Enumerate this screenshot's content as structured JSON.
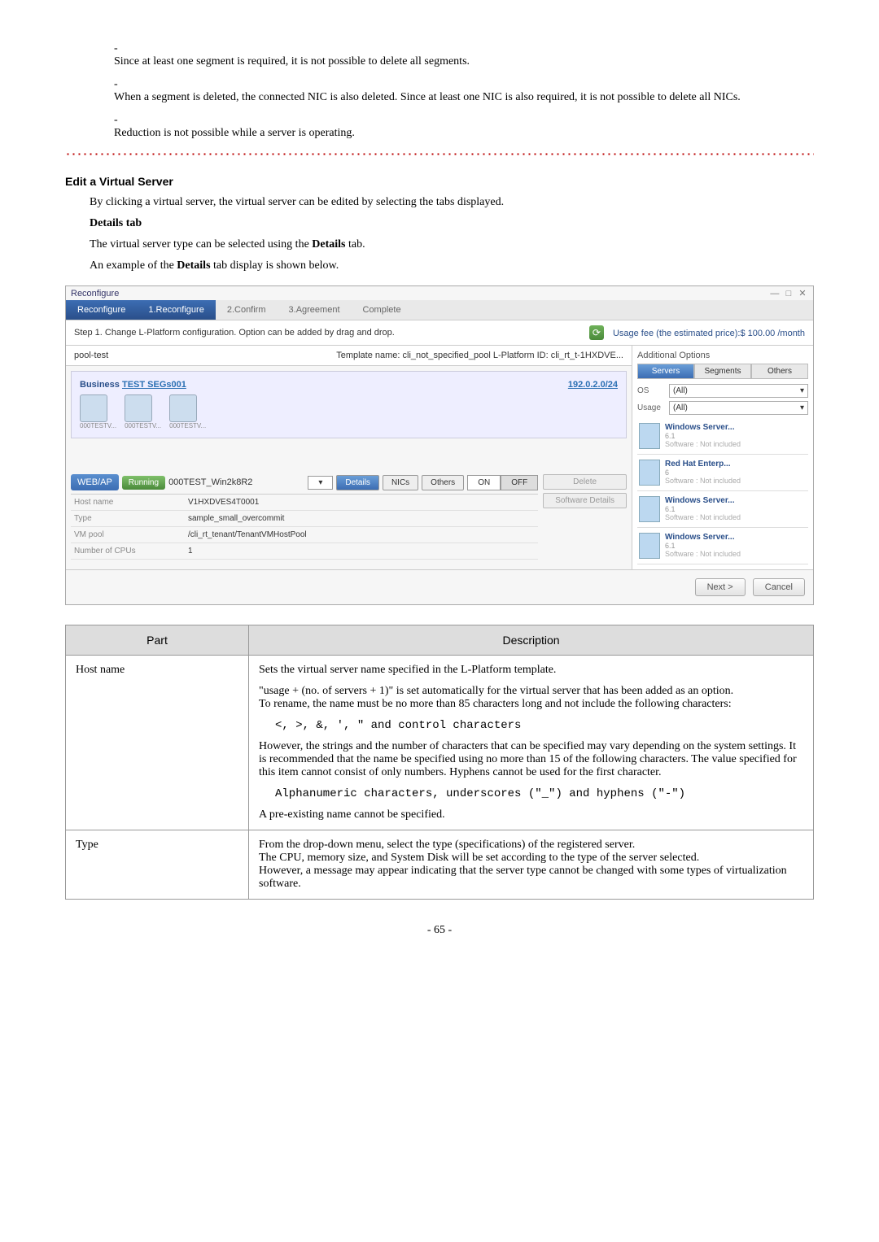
{
  "bullets": {
    "b1": "Since at least one segment is required, it is not possible to delete all segments.",
    "b2": "When a segment is deleted, the connected NIC is also deleted. Since at least one NIC is also required, it is not possible to delete all NICs.",
    "b3": "Reduction is not possible while a server is operating."
  },
  "section_heading": "Edit a Virtual Server",
  "intro_para": "By clicking a virtual server, the virtual server can be edited by selecting the tabs displayed.",
  "details_tab_heading": "Details tab",
  "details_line1_a": "The virtual server type can be selected using the ",
  "details_line1_b": "Details",
  "details_line1_c": " tab.",
  "details_line2_a": "An example of the ",
  "details_line2_b": "Details",
  "details_line2_c": " tab display is shown below.",
  "inset": {
    "window_title": "Reconfigure",
    "steps": {
      "s1": "1.Reconfigure",
      "s2": "2.Confirm",
      "s3": "3.Agreement",
      "s4": "Complete"
    },
    "step1_label": "Reconfigure",
    "step_desc": "Step 1. Change L-Platform configuration. Option can be added by drag and drop.",
    "fee_label": "Usage fee (the estimated price):$",
    "fee_amount": "100.00 /month",
    "pool_name": "pool-test",
    "template_label": "Template name: cli_not_specified_pool  L-Platform ID: cli_rt_t-1HXDVE...",
    "business_label": "Business",
    "business_link": "TEST SEGs001",
    "ip": "192.0.2.0/24",
    "srv_lbl": "000TESTV...",
    "brand": "WEB/AP",
    "status": "Running",
    "srv_name": "000TEST_Win2k8R2",
    "tabs": {
      "details": "Details",
      "nics": "NICs",
      "others": "Others"
    },
    "on": "ON",
    "off": "OFF",
    "detail_rows": {
      "host_name_lbl": "Host name",
      "host_name_val": "V1HXDVES4T0001",
      "type_lbl": "Type",
      "type_val": "sample_small_overcommit",
      "vmpool_lbl": "VM pool",
      "vmpool_val": "/cli_rt_tenant/TenantVMHostPool",
      "cpus_lbl": "Number of CPUs",
      "cpus_val": "1"
    },
    "side_btns": {
      "delete": "Delete",
      "sw": "Software Details"
    },
    "addopt_title": "Additional Options",
    "opt_tabs": {
      "servers": "Servers",
      "segments": "Segments",
      "others": "Others"
    },
    "opt_fields": {
      "os_lbl": "OS",
      "os_val": "(All)",
      "usage_lbl": "Usage",
      "usage_val": "(All)"
    },
    "cards": {
      "c1_name": "Windows Server...",
      "c1_sub": "6.1",
      "c1_sw": "Software : Not included",
      "c2_name": "Red Hat Enterp...",
      "c2_sub": "6",
      "c2_sw": "Software : Not included",
      "c3_name": "Windows Server...",
      "c3_sub": "6.1",
      "c3_sw": "Software : Not included",
      "c4_name": "Windows Server...",
      "c4_sub": "6.1",
      "c4_sw": "Software : Not included"
    },
    "footer": {
      "next": "Next >",
      "cancel": "Cancel"
    }
  },
  "table": {
    "hdr_part": "Part",
    "hdr_desc": "Description",
    "r1_part": "Host name",
    "r1_p1": "Sets the virtual server name specified in the L-Platform template.",
    "r1_p2": "\"usage + (no. of servers + 1)\" is set automatically for the virtual server that has been added as an option.",
    "r1_p3": "To rename, the name must be no more than 85 characters long and not include the following characters:",
    "r1_code1": "<, >, &, ', \" and control characters",
    "r1_p4": "However, the strings and the number of characters that can be specified may vary depending on the system settings. It is recommended that the name be specified using no more than 15 of the following characters. The value specified for this item cannot consist of only numbers. Hyphens cannot be used for the first character.",
    "r1_code2": "Alphanumeric characters, underscores (\"_\") and hyphens (\"-\")",
    "r1_p5": "A pre-existing name cannot be specified.",
    "r2_part": "Type",
    "r2_p1": "From the drop-down menu, select the type (specifications) of the registered server.",
    "r2_p2": "The CPU, memory size, and System Disk will be set according to the type of the server selected.",
    "r2_p3": "However, a message may appear indicating that the server type cannot be changed with some types of virtualization software."
  },
  "page_number": "- 65 -"
}
